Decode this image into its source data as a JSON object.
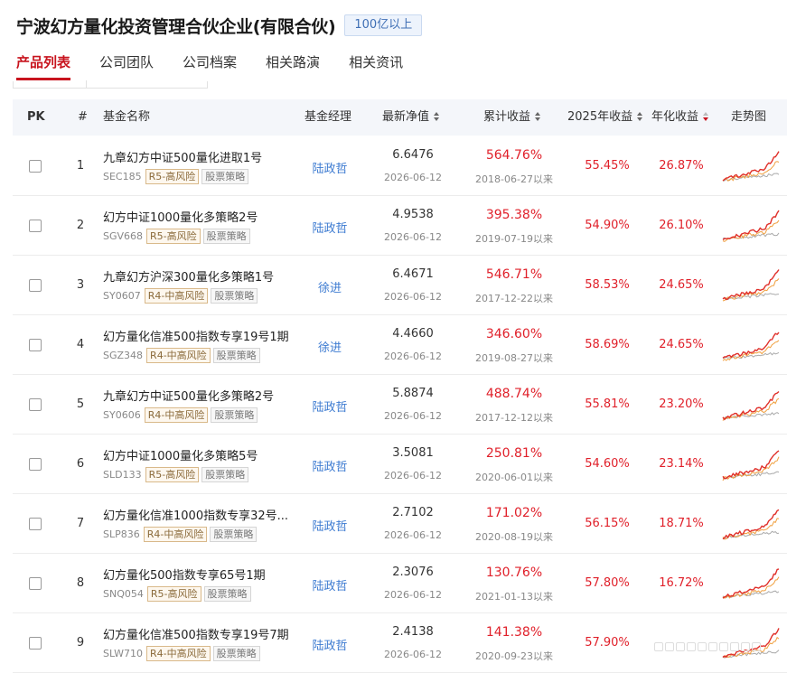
{
  "header": {
    "company_name": "宁波幻方量化投资管理合伙企业(有限合伙)",
    "size_badge": "100亿以上"
  },
  "tabs": [
    {
      "label": "产品列表",
      "active": true
    },
    {
      "label": "公司团队",
      "active": false
    },
    {
      "label": "公司档案",
      "active": false
    },
    {
      "label": "相关路演",
      "active": false
    },
    {
      "label": "相关资讯",
      "active": false
    }
  ],
  "table": {
    "columns": {
      "pk": "PK",
      "index": "#",
      "fund_name": "基金名称",
      "manager": "基金经理",
      "nav": "最新净值",
      "cumulative": "累计收益",
      "ytd": "2025年收益",
      "annualized": "年化收益",
      "trend": "走势图"
    },
    "colors": {
      "accent_red": "#c8141e",
      "gain_red": "#e0202a",
      "link_blue": "#3d7bd1",
      "trend_line_red": "#e0302a",
      "trend_line_orange": "#f0a040",
      "trend_line_gray": "#aaaaaa"
    },
    "rows": [
      {
        "index": "1",
        "name": "九章幻方中证500量化进取1号",
        "code": "SEC185",
        "risk": "R5-高风险",
        "strategy": "股票策略",
        "manager": "陆政哲",
        "nav": "6.6476",
        "nav_date": "2026-06-12",
        "cumulative": "564.76%",
        "since": "2018-06-27以来",
        "ytd": "55.45%",
        "annualized": "26.87%"
      },
      {
        "index": "2",
        "name": "幻方中证1000量化多策略2号",
        "code": "SGV668",
        "risk": "R5-高风险",
        "strategy": "股票策略",
        "manager": "陆政哲",
        "nav": "4.9538",
        "nav_date": "2026-06-12",
        "cumulative": "395.38%",
        "since": "2019-07-19以来",
        "ytd": "54.90%",
        "annualized": "26.10%"
      },
      {
        "index": "3",
        "name": "九章幻方沪深300量化多策略1号",
        "code": "SY0607",
        "risk": "R4-中高风险",
        "strategy": "股票策略",
        "manager": "徐进",
        "nav": "6.4671",
        "nav_date": "2026-06-12",
        "cumulative": "546.71%",
        "since": "2017-12-22以来",
        "ytd": "58.53%",
        "annualized": "24.65%"
      },
      {
        "index": "4",
        "name": "幻方量化信准500指数专享19号1期",
        "code": "SGZ348",
        "risk": "R4-中高风险",
        "strategy": "股票策略",
        "manager": "徐进",
        "nav": "4.4660",
        "nav_date": "2026-06-12",
        "cumulative": "346.60%",
        "since": "2019-08-27以来",
        "ytd": "58.69%",
        "annualized": "24.65%"
      },
      {
        "index": "5",
        "name": "九章幻方中证500量化多策略2号",
        "code": "SY0606",
        "risk": "R4-中高风险",
        "strategy": "股票策略",
        "manager": "陆政哲",
        "nav": "5.8874",
        "nav_date": "2026-06-12",
        "cumulative": "488.74%",
        "since": "2017-12-12以来",
        "ytd": "55.81%",
        "annualized": "23.20%"
      },
      {
        "index": "6",
        "name": "幻方中证1000量化多策略5号",
        "code": "SLD133",
        "risk": "R5-高风险",
        "strategy": "股票策略",
        "manager": "陆政哲",
        "nav": "3.5081",
        "nav_date": "2026-06-12",
        "cumulative": "250.81%",
        "since": "2020-06-01以来",
        "ytd": "54.60%",
        "annualized": "23.14%"
      },
      {
        "index": "7",
        "name": "幻方量化信准1000指数专享32号...",
        "code": "SLP836",
        "risk": "R4-中高风险",
        "strategy": "股票策略",
        "manager": "陆政哲",
        "nav": "2.7102",
        "nav_date": "2026-06-12",
        "cumulative": "171.02%",
        "since": "2020-08-19以来",
        "ytd": "56.15%",
        "annualized": "18.71%"
      },
      {
        "index": "8",
        "name": "幻方量化500指数专享65号1期",
        "code": "SNQ054",
        "risk": "R5-高风险",
        "strategy": "股票策略",
        "manager": "陆政哲",
        "nav": "2.3076",
        "nav_date": "2026-06-12",
        "cumulative": "130.76%",
        "since": "2021-01-13以来",
        "ytd": "57.80%",
        "annualized": "16.72%"
      },
      {
        "index": "9",
        "name": "幻方量化信准500指数专享19号7期",
        "code": "SLW710",
        "risk": "R4-中高风险",
        "strategy": "股票策略",
        "manager": "陆政哲",
        "nav": "2.4138",
        "nav_date": "2026-06-12",
        "cumulative": "141.38%",
        "since": "2020-09-23以来",
        "ytd": "57.90%",
        "annualized": ""
      }
    ]
  }
}
